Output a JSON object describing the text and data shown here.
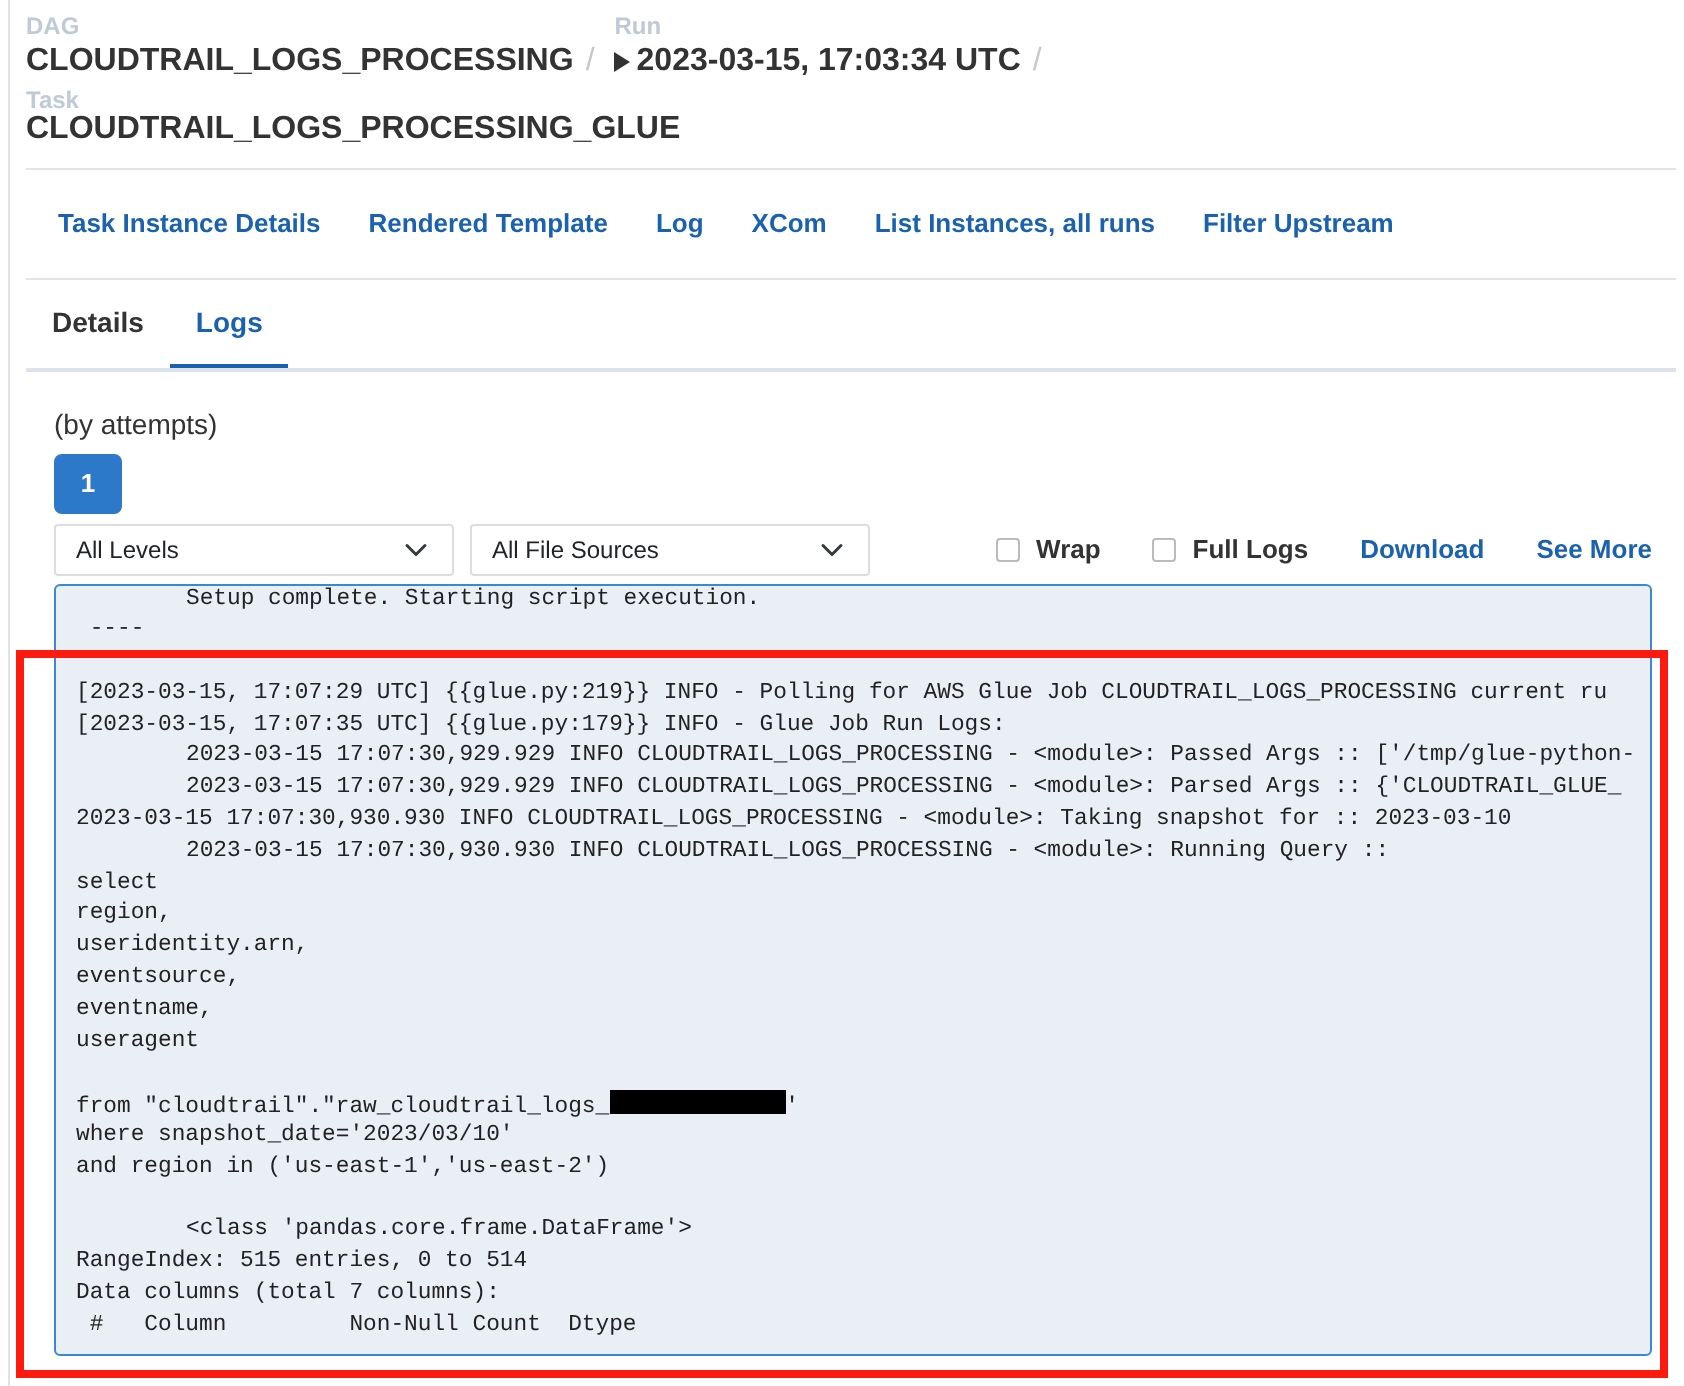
{
  "breadcrumbs": [
    {
      "label": "DAG",
      "value": "CLOUDTRAIL_LOGS_PROCESSING",
      "separator": "/"
    },
    {
      "label": "Run",
      "value": "2023-03-15, 17:03:34 UTC",
      "separator": "/",
      "kind": "run"
    },
    {
      "label": "Task",
      "value": "CLOUDTRAIL_LOGS_PROCESSING_GLUE"
    }
  ],
  "nav_links": [
    "Task Instance Details",
    "Rendered Template",
    "Log",
    "XCom",
    "List Instances, all runs",
    "Filter Upstream"
  ],
  "tabs": [
    {
      "label": "Details",
      "selected": false
    },
    {
      "label": "Logs",
      "selected": true
    }
  ],
  "attempts": {
    "label": "(by attempts)",
    "buttons": [
      {
        "label": "1",
        "selected": true
      }
    ]
  },
  "filters": [
    {
      "value": "All Levels"
    },
    {
      "value": "All File Sources"
    }
  ],
  "options": [
    {
      "label": "Wrap",
      "checked": false
    },
    {
      "label": "Full Logs",
      "checked": false
    }
  ],
  "actions": [
    "Download",
    "See More"
  ],
  "log_lines": [
    {
      "text": "Setup complete. Starting script execution.",
      "indent": true
    },
    {
      "text": " ----",
      "indent": false
    },
    {
      "kind": "blank"
    },
    {
      "text": "[2023-03-15, 17:07:29 UTC] {{glue.py:219}} INFO - Polling for AWS Glue Job CLOUDTRAIL_LOGS_PROCESSING current ru",
      "indent": false
    },
    {
      "text": "[2023-03-15, 17:07:35 UTC] {{glue.py:179}} INFO - Glue Job Run Logs:",
      "indent": false
    },
    {
      "text": "2023-03-15 17:07:30,929.929 INFO CLOUDTRAIL_LOGS_PROCESSING - <module>: Passed Args :: ['/tmp/glue-python-",
      "indent": true
    },
    {
      "text": "2023-03-15 17:07:30,929.929 INFO CLOUDTRAIL_LOGS_PROCESSING - <module>: Parsed Args :: {'CLOUDTRAIL_GLUE_",
      "indent": true
    },
    {
      "text": "2023-03-15 17:07:30,930.930 INFO CLOUDTRAIL_LOGS_PROCESSING - <module>: Taking snapshot for :: 2023-03-10",
      "indent": false
    },
    {
      "text": "2023-03-15 17:07:30,930.930 INFO CLOUDTRAIL_LOGS_PROCESSING - <module>: Running Query ::",
      "indent": true
    },
    {
      "text": "select",
      "indent": false
    },
    {
      "text": "region,",
      "indent": false
    },
    {
      "text": "useridentity.arn,",
      "indent": false
    },
    {
      "text": "eventsource,",
      "indent": false
    },
    {
      "text": "eventname,",
      "indent": false
    },
    {
      "text": "useragent",
      "indent": false
    },
    {
      "kind": "blank"
    },
    {
      "text": "from \"cloudtrail\".\"raw_cloudtrail_logs_",
      "after": "'",
      "indent": false,
      "kind": "redacted"
    },
    {
      "text": "where snapshot_date='2023/03/10'",
      "indent": false
    },
    {
      "text": "and region in ('us-east-1','us-east-2')",
      "indent": false
    },
    {
      "kind": "blank"
    },
    {
      "text": "<class 'pandas.core.frame.DataFrame'>",
      "indent": true
    },
    {
      "text": "RangeIndex: 515 entries, 0 to 514",
      "indent": false
    },
    {
      "text": "Data columns (total 7 columns):",
      "indent": false
    },
    {
      "text": " #   Column         Non-Null Count  Dtype",
      "indent": false
    }
  ]
}
